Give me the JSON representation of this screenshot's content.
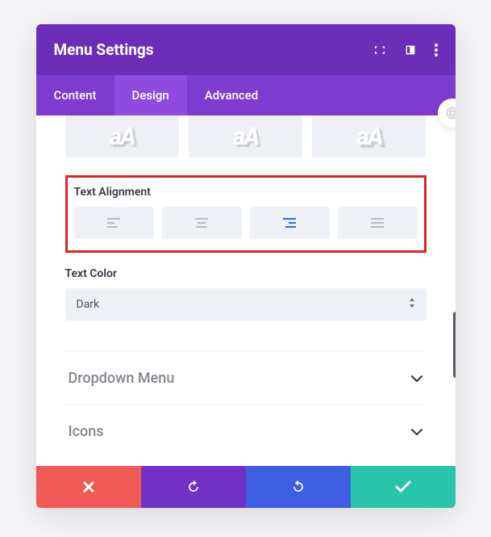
{
  "header": {
    "title": "Menu Settings"
  },
  "tabs": {
    "content": "Content",
    "design": "Design",
    "advanced": "Advanced",
    "active": "Design"
  },
  "text_shadow": {
    "sample": "aA"
  },
  "text_alignment": {
    "label": "Text Alignment",
    "options": [
      "left",
      "center",
      "right",
      "justify"
    ],
    "selected": "right"
  },
  "text_color": {
    "label": "Text Color",
    "value": "Dark"
  },
  "accordion": {
    "dropdown_menu": "Dropdown Menu",
    "icons": "Icons"
  },
  "footer": {
    "actions": [
      "close",
      "undo",
      "redo",
      "confirm"
    ]
  },
  "colors": {
    "header": "#6c2eb9",
    "tabs": "#7e3bd0",
    "tab_active": "#8e4be0",
    "highlight": "#e02424",
    "accent_blue": "#2b6ef2",
    "btn_red": "#ef5b54",
    "btn_purple": "#7231c6",
    "btn_blue": "#3d5ee0",
    "btn_green": "#29c4a9"
  }
}
